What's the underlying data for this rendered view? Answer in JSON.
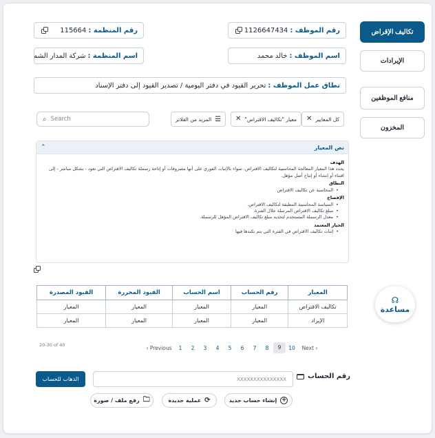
{
  "sidebar": {
    "items": [
      {
        "label": "تكاليف الإقراض"
      },
      {
        "label": "الإيرادات"
      },
      {
        "label": "منافع الموظفين"
      },
      {
        "label": "المخزون"
      }
    ]
  },
  "info": {
    "employee_no": {
      "label": "رقم الموظف :",
      "value": "1126647434"
    },
    "org_no": {
      "label": "رقم المنظمة :",
      "value": "115664"
    },
    "employee_name": {
      "label": "اسم الموظف :",
      "value": "خالد محمد"
    },
    "org_name": {
      "label": "اسم المنظمة :",
      "value": "شركة المدار الشمالي"
    },
    "scope": {
      "label": "نطاق عمل الموظف :",
      "value": "تحرير القيود في دفتر اليومية / تصدير القيود إلى دفتر الإسناد"
    }
  },
  "filters": {
    "chips": [
      {
        "label": "كل المعايير"
      },
      {
        "label": "معيار \"تكاليف الاقتراض\""
      }
    ],
    "more": "المزيد من الفلاتر",
    "search_placeholder": "Search"
  },
  "standard": {
    "title": "نص المعيار",
    "sections": [
      {
        "heading": "الهدف",
        "text": "يحدد هذا المعيار المعالجة المحاسبية لتكاليف الاقتراض، سواء بالإثبات الفوري على أنها مصروفات أو إتاحة رسملة تكاليف الاقتراض التي تعود - بشكل مباشر - إلى اقتناء أو إنشاء أو إنتاج أصل مؤهل."
      },
      {
        "heading": "النطاق",
        "items": [
          "المحاسبة عن تكاليف الاقتراض"
        ]
      },
      {
        "heading": "الإفصاح",
        "items": [
          "السياسة المحاسبية المطبقة لتكاليف الاقتراض.",
          "مبلغ تكاليف الاقتراض المرسلة خلال الفترة.",
          "معدل الرسملة المستخدم لتحديد مبلغ تكاليف الاقتراض المؤهل للرسملة."
        ]
      },
      {
        "heading": "الخيار المعتمد",
        "items": [
          "إثبات تكاليف الاقتراض في الفترة التي يتم تكبدها فيها"
        ]
      }
    ]
  },
  "table": {
    "headers": [
      "المعيار",
      "رقم الحساب",
      "اسم الحساب",
      "القيود المحررة",
      "القيود المصدرة"
    ],
    "rows": [
      [
        "تكاليف الاقتراض",
        "المعيار",
        "المعيار",
        "المعيار",
        "المعيار"
      ],
      [
        "الإيراد",
        "المعيار",
        "المعيار",
        "المعيار",
        "المعيار"
      ]
    ]
  },
  "pagination": {
    "range": "20-30 of 40",
    "previous": "Previous",
    "next": "Next",
    "pages": [
      "1",
      "2",
      "3",
      "4",
      "5",
      "6",
      "7",
      "8",
      "9",
      "10"
    ],
    "current": "9"
  },
  "account": {
    "label": "رقم الحساب",
    "placeholder": "XXXXXXXXXXXXXXX",
    "go_button": "الذهاب للحساب"
  },
  "actions": {
    "new_account": "إنشاء حساب جديد",
    "new_operation": "عملية جديدة",
    "upload": "رفع ملف / صورة"
  },
  "help": {
    "label": "مساعدة"
  },
  "colors": {
    "primary": "#0a5a8c"
  }
}
